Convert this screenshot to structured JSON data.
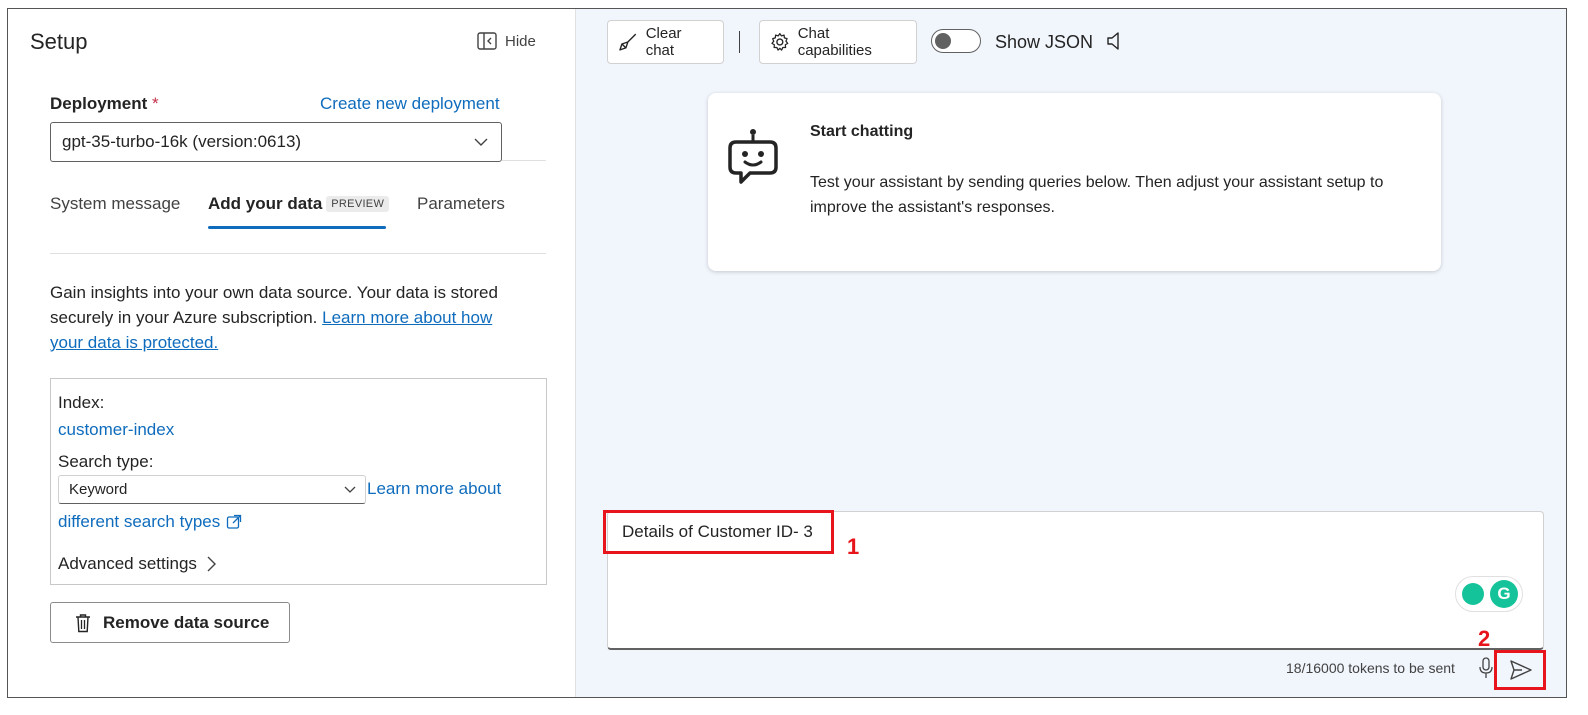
{
  "setup": {
    "title": "Setup",
    "hide_label": "Hide",
    "deployment_label": "Deployment",
    "required_mark": "*",
    "create_link": "Create new deployment",
    "deployment_value": "gpt-35-turbo-16k (version:0613)",
    "tabs": [
      {
        "label": "System message"
      },
      {
        "label": "Add your data",
        "badge": "PREVIEW",
        "active": true
      },
      {
        "label": "Parameters"
      }
    ],
    "description_text": "Gain insights into your own data source. Your data is stored securely in your Azure subscription. ",
    "description_link": "Learn more about how your data is protected.",
    "index_label": "Index:",
    "index_value": "customer-index",
    "search_type_label": "Search type:",
    "search_type_value": "Keyword",
    "learn_link_1": "Learn more about",
    "learn_link_2": "different search types",
    "advanced_settings": "Advanced settings",
    "remove_button": "Remove data source"
  },
  "toolbar": {
    "clear_chat": "Clear chat",
    "separator": "|",
    "chat_capabilities": "Chat capabilities",
    "show_json_label": "Show JSON",
    "show_json_on": false
  },
  "start_card": {
    "title": "Start chatting",
    "text": "Test your assistant by sending queries below. Then adjust your assistant setup to improve the assistant's responses."
  },
  "chat_input": {
    "value": "Details of Customer ID- 3",
    "tokens": "18/16000 tokens to be sent"
  },
  "annotations": {
    "step1": "1",
    "step2": "2",
    "color": "#e8141c"
  },
  "colors": {
    "accent": "#0f6cbd",
    "background": "#f1f5fc",
    "grammarly": "#15c39a"
  },
  "icons": [
    "hide-panel-icon",
    "chevron-down-icon",
    "external-link-icon",
    "chevron-right-icon",
    "trash-icon",
    "broom-icon",
    "gear-icon",
    "speaker-icon",
    "robot-icon",
    "mic-icon",
    "send-icon",
    "grammarly-icon"
  ]
}
